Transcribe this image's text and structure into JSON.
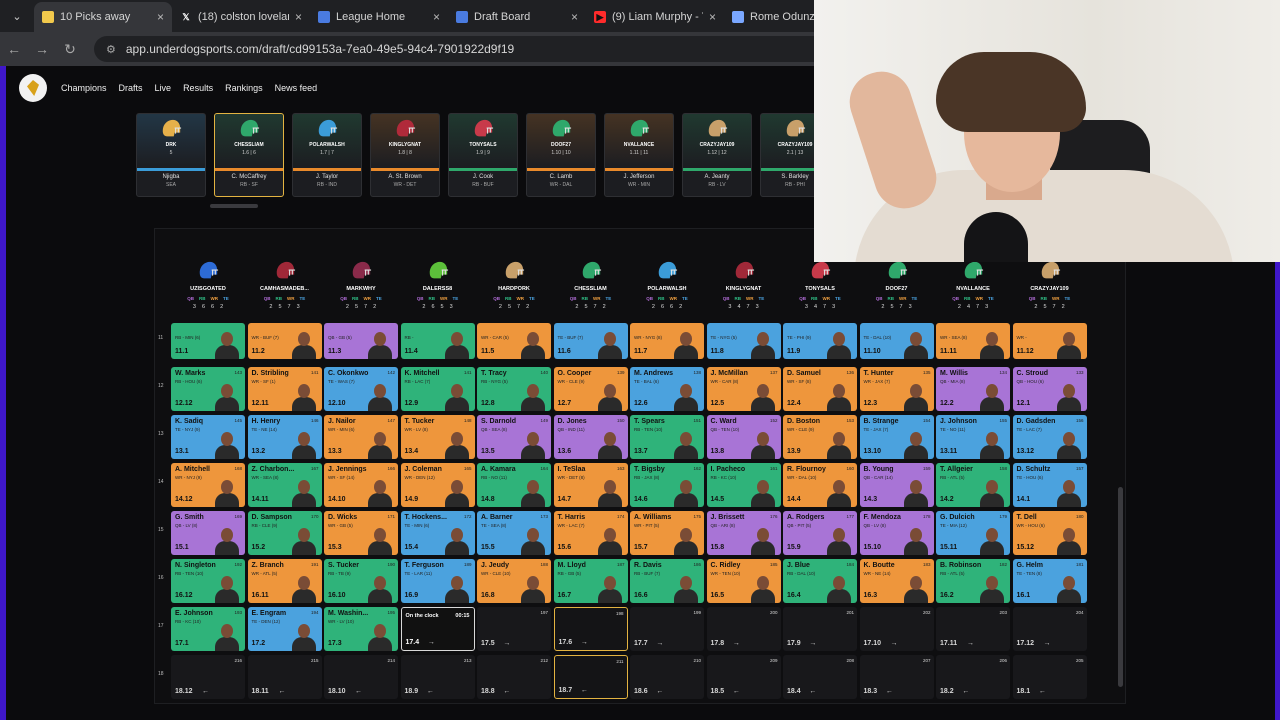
{
  "browser": {
    "tabs": [
      {
        "title": "10 Picks away",
        "icon": "underdog-icon",
        "icon_color": "#f2c94c",
        "active": true,
        "close": "×"
      },
      {
        "title": "(18) colston loveland",
        "icon": "x-icon",
        "icon_color": "#ffffff",
        "active": false,
        "close": "×"
      },
      {
        "title": "League Home",
        "icon": "sheets-icon",
        "icon_color": "#4a7be0",
        "active": false,
        "close": "×"
      },
      {
        "title": "Draft Board",
        "icon": "sheets-icon",
        "icon_color": "#4a7be0",
        "active": false,
        "close": "×"
      },
      {
        "title": "(9) Liam Murphy - Y",
        "icon": "youtube-icon",
        "icon_color": "#ff2b2b",
        "active": false,
        "close": "×"
      },
      {
        "title": "Rome Odunze",
        "icon": "page-icon",
        "icon_color": "#7aa7ff",
        "active": false,
        "close": ""
      }
    ],
    "url": "app.underdogsports.com/draft/cd99153a-7ea0-49e5-94c4-7901922d9f19"
  },
  "nav": {
    "links": [
      "Champions",
      "Drafts",
      "Live",
      "Results",
      "Rankings",
      "News feed"
    ]
  },
  "strip": {
    "picks": [
      {
        "team": "DRK",
        "pick": "5",
        "player": "Njigba",
        "pos": "SEA",
        "color": "#3b9cd8",
        "helmet": "#e6b04a",
        "bar": "#3b9cd8"
      },
      {
        "team": "CHESSLIAM",
        "pick": "1.6 | 6",
        "player": "C. McCaffrey",
        "pos": "RB - SF",
        "color": "#2fa86b",
        "helmet": "#2fa86b",
        "bar": "#e98a2b",
        "selected": true
      },
      {
        "team": "POLARWALSH",
        "pick": "1.7 | 7",
        "player": "J. Taylor",
        "pos": "RB - IND",
        "color": "#2fa86b",
        "helmet": "#3b9cd8",
        "bar": "#e98a2b"
      },
      {
        "team": "KINGLYGNAT",
        "pick": "1.8 | 8",
        "player": "A. St. Brown",
        "pos": "WR - DET",
        "color": "#e98a2b",
        "helmet": "#b02a3a",
        "bar": "#e98a2b"
      },
      {
        "team": "TONYSALS",
        "pick": "1.9 | 9",
        "player": "J. Cook",
        "pos": "RB - BUF",
        "color": "#2fa86b",
        "helmet": "#c83a4a",
        "bar": "#2fa86b"
      },
      {
        "team": "DOOF27",
        "pick": "1.10 | 10",
        "player": "C. Lamb",
        "pos": "WR - DAL",
        "color": "#e98a2b",
        "helmet": "#2fa86b",
        "bar": "#e98a2b"
      },
      {
        "team": "NVALLANCE",
        "pick": "1.11 | 11",
        "player": "J. Jefferson",
        "pos": "WR - MIN",
        "color": "#e98a2b",
        "helmet": "#2fa86b",
        "bar": "#e98a2b"
      },
      {
        "team": "CRAZYJAY109",
        "pick": "1.12 | 12",
        "player": "A. Jeanty",
        "pos": "RB - LV",
        "color": "#2fa86b",
        "helmet": "#c8a06a",
        "bar": "#2fa86b"
      },
      {
        "team": "CRAZYJAY109",
        "pick": "2.1 | 13",
        "player": "S. Barkley",
        "pos": "RB - PHI",
        "color": "#2fa86b",
        "helmet": "#c8a06a",
        "bar": "#2fa86b"
      }
    ]
  },
  "board": {
    "pos_labels": [
      "QB",
      "RB",
      "WR",
      "TE"
    ],
    "pos_colors": {
      "QB": "#b06cd6",
      "RB": "#2fbf86",
      "WR": "#f0a040",
      "TE": "#4aa3e0"
    },
    "teams": [
      {
        "name": "UZISGOATED",
        "counts": [
          "3",
          "6",
          "6",
          "2"
        ],
        "helmet": "#2d6bd6"
      },
      {
        "name": "CAMHASMADEB...",
        "counts": [
          "2",
          "5",
          "7",
          "3"
        ],
        "helmet": "#a02838"
      },
      {
        "name": "MARKWHY",
        "counts": [
          "2",
          "5",
          "7",
          "2"
        ],
        "helmet": "#8a2a4a"
      },
      {
        "name": "DALERSS8",
        "counts": [
          "2",
          "6",
          "5",
          "3"
        ],
        "helmet": "#5cc03a"
      },
      {
        "name": "HARDPORK",
        "counts": [
          "2",
          "5",
          "7",
          "2"
        ],
        "helmet": "#c8a06a"
      },
      {
        "name": "CHESSLIAM",
        "counts": [
          "2",
          "5",
          "7",
          "2"
        ],
        "helmet": "#2fa86b"
      },
      {
        "name": "POLARWALSH",
        "counts": [
          "2",
          "6",
          "6",
          "2"
        ],
        "helmet": "#3b9cd8"
      },
      {
        "name": "KINGLYGNAT",
        "counts": [
          "3",
          "4",
          "7",
          "3"
        ],
        "helmet": "#a02838"
      },
      {
        "name": "TONYSALS",
        "counts": [
          "3",
          "4",
          "7",
          "3"
        ],
        "helmet": "#c83a4a"
      },
      {
        "name": "DOOF27",
        "counts": [
          "2",
          "5",
          "7",
          "3"
        ],
        "helmet": "#2fa86b"
      },
      {
        "name": "NVALLANCE",
        "counts": [
          "2",
          "4",
          "7",
          "3"
        ],
        "helmet": "#2fa86b"
      },
      {
        "name": "CRAZYJAY109",
        "counts": [
          "2",
          "5",
          "7",
          "2"
        ],
        "helmet": "#c8a06a"
      }
    ],
    "round_labels": [
      "11",
      "12",
      "13",
      "14",
      "15",
      "16",
      "17",
      "18"
    ],
    "rounds": [
      [
        {
          "n": "",
          "p": "RB - MIN (6)",
          "i": "",
          "s": "11.1",
          "pos": "RB"
        },
        {
          "n": "",
          "p": "WR - BUF (7)",
          "i": "",
          "s": "11.2",
          "pos": "WR"
        },
        {
          "n": "",
          "p": "QB - GB (5)",
          "i": "",
          "s": "11.3",
          "pos": "QB"
        },
        {
          "n": "",
          "p": "RB - ",
          "i": "",
          "s": "11.4",
          "pos": "RB"
        },
        {
          "n": "",
          "p": "WR - CAR (5)",
          "i": "",
          "s": "11.5",
          "pos": "WR"
        },
        {
          "n": "",
          "p": "TE - BUF (7)",
          "i": "",
          "s": "11.6",
          "pos": "TE"
        },
        {
          "n": "",
          "p": "WR - NYG (8)",
          "i": "",
          "s": "11.7",
          "pos": "WR"
        },
        {
          "n": "",
          "p": "TE - NYG (5)",
          "i": "",
          "s": "11.8",
          "pos": "TE"
        },
        {
          "n": "",
          "p": "TE - PHI (9)",
          "i": "",
          "s": "11.9",
          "pos": "TE"
        },
        {
          "n": "",
          "p": "TE - DAL (10)",
          "i": "",
          "s": "11.10",
          "pos": "TE"
        },
        {
          "n": "",
          "p": "WR - SEA (8)",
          "i": "",
          "s": "11.11",
          "pos": "WR"
        },
        {
          "n": "",
          "p": "WR - ",
          "i": "",
          "s": "11.12",
          "pos": "WR"
        }
      ],
      [
        {
          "n": "W. Marks",
          "p": "RB - HOU (6)",
          "i": "143",
          "s": "12.12",
          "pos": "RB"
        },
        {
          "n": "D. Stribling",
          "p": "WR - SF (1)",
          "i": "141",
          "s": "12.11",
          "pos": "WR"
        },
        {
          "n": "C. Okonkwo",
          "p": "TE - WAS (7)",
          "i": "142",
          "s": "12.10",
          "pos": "TE"
        },
        {
          "n": "K. Mitchell",
          "p": "RB - LAC (7)",
          "i": "141",
          "s": "12.9",
          "pos": "RB"
        },
        {
          "n": "T. Tracy",
          "p": "RB - NYG (5)",
          "i": "140",
          "s": "12.8",
          "pos": "RB"
        },
        {
          "n": "O. Cooper",
          "p": "WR - CLE (9)",
          "i": "139",
          "s": "12.7",
          "pos": "WR"
        },
        {
          "n": "M. Andrews",
          "p": "TE - BAL (6)",
          "i": "138",
          "s": "12.6",
          "pos": "TE"
        },
        {
          "n": "J. McMillan",
          "p": "WR - CAR (8)",
          "i": "137",
          "s": "12.5",
          "pos": "WR"
        },
        {
          "n": "D. Samuel",
          "p": "WR - SF (8)",
          "i": "136",
          "s": "12.4",
          "pos": "WR"
        },
        {
          "n": "T. Hunter",
          "p": "WR - JAX (7)",
          "i": "135",
          "s": "12.3",
          "pos": "WR"
        },
        {
          "n": "M. Willis",
          "p": "QB - MIA (8)",
          "i": "134",
          "s": "12.2",
          "pos": "QB"
        },
        {
          "n": "C. Stroud",
          "p": "QB - HOU (6)",
          "i": "133",
          "s": "12.1",
          "pos": "QB"
        }
      ],
      [
        {
          "n": "K. Sadiq",
          "p": "TE - NYJ (9)",
          "i": "145",
          "s": "13.1",
          "pos": "TE"
        },
        {
          "n": "H. Henry",
          "p": "TE - NE (14)",
          "i": "146",
          "s": "13.2",
          "pos": "TE"
        },
        {
          "n": "J. Nailor",
          "p": "WR - MIN (6)",
          "i": "147",
          "s": "13.3",
          "pos": "WR"
        },
        {
          "n": "T. Tucker",
          "p": "WR - LV (8)",
          "i": "148",
          "s": "13.4",
          "pos": "WR"
        },
        {
          "n": "S. Darnold",
          "p": "QB - SEA (8)",
          "i": "149",
          "s": "13.5",
          "pos": "QB"
        },
        {
          "n": "D. Jones",
          "p": "QB - IND (11)",
          "i": "150",
          "s": "13.6",
          "pos": "QB"
        },
        {
          "n": "T. Spears",
          "p": "RB - TEN (10)",
          "i": "151",
          "s": "13.7",
          "pos": "RB"
        },
        {
          "n": "C. Ward",
          "p": "QB - TEN (10)",
          "i": "152",
          "s": "13.8",
          "pos": "QB"
        },
        {
          "n": "D. Boston",
          "p": "WR - CLE (9)",
          "i": "153",
          "s": "13.9",
          "pos": "WR"
        },
        {
          "n": "B. Strange",
          "p": "TE - JAX (7)",
          "i": "154",
          "s": "13.10",
          "pos": "TE"
        },
        {
          "n": "J. Johnson",
          "p": "TE - NO (11)",
          "i": "155",
          "s": "13.11",
          "pos": "TE"
        },
        {
          "n": "D. Gadsden",
          "p": "TE - LAC (7)",
          "i": "156",
          "s": "13.12",
          "pos": "TE"
        }
      ],
      [
        {
          "n": "A. Mitchell",
          "p": "WR - NYJ (9)",
          "i": "168",
          "s": "14.12",
          "pos": "WR"
        },
        {
          "n": "Z. Charbon...",
          "p": "WR - SEA (8)",
          "i": "167",
          "s": "14.11",
          "pos": "RB"
        },
        {
          "n": "J. Jennings",
          "p": "WR - SF (14)",
          "i": "166",
          "s": "14.10",
          "pos": "WR"
        },
        {
          "n": "J. Coleman",
          "p": "WR - DEN (12)",
          "i": "165",
          "s": "14.9",
          "pos": "WR"
        },
        {
          "n": "A. Kamara",
          "p": "RB - NO (11)",
          "i": "164",
          "s": "14.8",
          "pos": "RB"
        },
        {
          "n": "I. TeSlaa",
          "p": "WR - DET (8)",
          "i": "163",
          "s": "14.7",
          "pos": "WR"
        },
        {
          "n": "T. Bigsby",
          "p": "RB - JAX (8)",
          "i": "162",
          "s": "14.6",
          "pos": "RB"
        },
        {
          "n": "I. Pacheco",
          "p": "RB - KC (10)",
          "i": "161",
          "s": "14.5",
          "pos": "RB"
        },
        {
          "n": "R. Flournoy",
          "p": "WR - DAL (10)",
          "i": "160",
          "s": "14.4",
          "pos": "WR"
        },
        {
          "n": "B. Young",
          "p": "QB - CAR (14)",
          "i": "159",
          "s": "14.3",
          "pos": "QB"
        },
        {
          "n": "T. Allgeier",
          "p": "RB - ATL (5)",
          "i": "158",
          "s": "14.2",
          "pos": "RB"
        },
        {
          "n": "D. Schultz",
          "p": "TE - HOU (6)",
          "i": "157",
          "s": "14.1",
          "pos": "TE"
        }
      ],
      [
        {
          "n": "G. Smith",
          "p": "QB - LV (8)",
          "i": "169",
          "s": "15.1",
          "pos": "QB"
        },
        {
          "n": "D. Sampson",
          "p": "RB - CLE (9)",
          "i": "170",
          "s": "15.2",
          "pos": "RB"
        },
        {
          "n": "D. Wicks",
          "p": "WR - GB (5)",
          "i": "171",
          "s": "15.3",
          "pos": "WR"
        },
        {
          "n": "T. Hockens...",
          "p": "TE - MIN (6)",
          "i": "172",
          "s": "15.4",
          "pos": "TE"
        },
        {
          "n": "A. Barner",
          "p": "TE - SEA (8)",
          "i": "173",
          "s": "15.5",
          "pos": "TE"
        },
        {
          "n": "T. Harris",
          "p": "WR - LAC (7)",
          "i": "174",
          "s": "15.6",
          "pos": "WR"
        },
        {
          "n": "A. Williams",
          "p": "WR - PIT (5)",
          "i": "175",
          "s": "15.7",
          "pos": "WR"
        },
        {
          "n": "J. Brissett",
          "p": "QB - ARI (8)",
          "i": "176",
          "s": "15.8",
          "pos": "QB"
        },
        {
          "n": "A. Rodgers",
          "p": "QB - PIT (5)",
          "i": "177",
          "s": "15.9",
          "pos": "QB"
        },
        {
          "n": "F. Mendoza",
          "p": "QB - LV (8)",
          "i": "178",
          "s": "15.10",
          "pos": "QB"
        },
        {
          "n": "G. Dulcich",
          "p": "TE - MIA (12)",
          "i": "179",
          "s": "15.11",
          "pos": "TE"
        },
        {
          "n": "T. Dell",
          "p": "WR - HOU (6)",
          "i": "180",
          "s": "15.12",
          "pos": "WR"
        }
      ],
      [
        {
          "n": "N. Singleton",
          "p": "RB - TEN (10)",
          "i": "192",
          "s": "16.12",
          "pos": "RB"
        },
        {
          "n": "Z. Branch",
          "p": "WR - ATL (5)",
          "i": "191",
          "s": "16.11",
          "pos": "WR"
        },
        {
          "n": "S. Tucker",
          "p": "RB - TB (9)",
          "i": "190",
          "s": "16.10",
          "pos": "RB"
        },
        {
          "n": "T. Ferguson",
          "p": "TE - LAR (11)",
          "i": "189",
          "s": "16.9",
          "pos": "TE"
        },
        {
          "n": "J. Jeudy",
          "p": "WR - CLE (10)",
          "i": "188",
          "s": "16.8",
          "pos": "WR"
        },
        {
          "n": "M. Lloyd",
          "p": "RB - GB (5)",
          "i": "187",
          "s": "16.7",
          "pos": "RB"
        },
        {
          "n": "R. Davis",
          "p": "RB - BUF (7)",
          "i": "186",
          "s": "16.6",
          "pos": "RB"
        },
        {
          "n": "C. Ridley",
          "p": "WR - TEN (10)",
          "i": "185",
          "s": "16.5",
          "pos": "WR"
        },
        {
          "n": "J. Blue",
          "p": "RB - DAL (10)",
          "i": "184",
          "s": "16.4",
          "pos": "RB"
        },
        {
          "n": "K. Boutte",
          "p": "WR - NE (14)",
          "i": "183",
          "s": "16.3",
          "pos": "WR"
        },
        {
          "n": "B. Robinson",
          "p": "RB - ATL (5)",
          "i": "182",
          "s": "16.2",
          "pos": "RB"
        },
        {
          "n": "G. Helm",
          "p": "TE - TEN (8)",
          "i": "181",
          "s": "16.1",
          "pos": "TE"
        }
      ],
      [
        {
          "n": "E. Johnson",
          "p": "RB - KC (10)",
          "i": "193",
          "s": "17.1",
          "pos": "RB"
        },
        {
          "n": "E. Engram",
          "p": "TE - DEN (12)",
          "i": "194",
          "s": "17.2",
          "pos": "TE"
        },
        {
          "n": "M. Washin...",
          "p": "WR - LV (10)",
          "i": "195",
          "s": "17.3",
          "pos": "RB"
        },
        {
          "n": "",
          "p": "",
          "i": "",
          "s": "17.4",
          "pos": "",
          "otc": true,
          "label": "On the clock",
          "timer": "00:15"
        },
        {
          "n": "",
          "p": "",
          "i": "197",
          "s": "17.5",
          "pos": ""
        },
        {
          "n": "",
          "p": "",
          "i": "198",
          "s": "17.6",
          "pos": "",
          "sel": true
        },
        {
          "n": "",
          "p": "",
          "i": "199",
          "s": "17.7",
          "pos": ""
        },
        {
          "n": "",
          "p": "",
          "i": "200",
          "s": "17.8",
          "pos": ""
        },
        {
          "n": "",
          "p": "",
          "i": "201",
          "s": "17.9",
          "pos": ""
        },
        {
          "n": "",
          "p": "",
          "i": "202",
          "s": "17.10",
          "pos": ""
        },
        {
          "n": "",
          "p": "",
          "i": "203",
          "s": "17.11",
          "pos": ""
        },
        {
          "n": "",
          "p": "",
          "i": "204",
          "s": "17.12",
          "pos": ""
        }
      ],
      [
        {
          "n": "",
          "p": "",
          "i": "216",
          "s": "18.12",
          "pos": ""
        },
        {
          "n": "",
          "p": "",
          "i": "215",
          "s": "18.11",
          "pos": ""
        },
        {
          "n": "",
          "p": "",
          "i": "214",
          "s": "18.10",
          "pos": ""
        },
        {
          "n": "",
          "p": "",
          "i": "213",
          "s": "18.9",
          "pos": ""
        },
        {
          "n": "",
          "p": "",
          "i": "212",
          "s": "18.8",
          "pos": ""
        },
        {
          "n": "",
          "p": "",
          "i": "211",
          "s": "18.7",
          "pos": "",
          "sel": true
        },
        {
          "n": "",
          "p": "",
          "i": "210",
          "s": "18.6",
          "pos": ""
        },
        {
          "n": "",
          "p": "",
          "i": "209",
          "s": "18.5",
          "pos": ""
        },
        {
          "n": "",
          "p": "",
          "i": "208",
          "s": "18.4",
          "pos": ""
        },
        {
          "n": "",
          "p": "",
          "i": "207",
          "s": "18.3",
          "pos": ""
        },
        {
          "n": "",
          "p": "",
          "i": "206",
          "s": "18.2",
          "pos": ""
        },
        {
          "n": "",
          "p": "",
          "i": "205",
          "s": "18.1",
          "pos": ""
        }
      ]
    ],
    "cell_colors": {
      "QB": "#a874d6",
      "RB": "#2fb37a",
      "WR": "#ee963c",
      "TE": "#4ba2de"
    }
  }
}
